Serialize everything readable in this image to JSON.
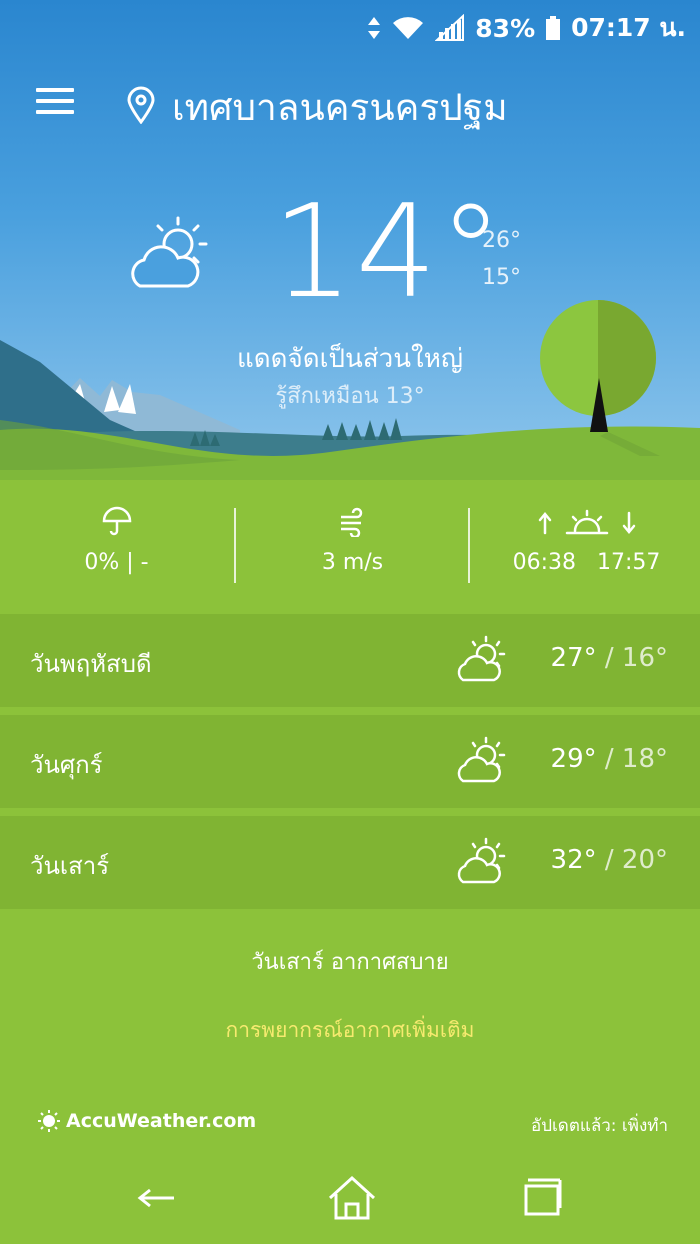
{
  "status_bar": {
    "battery": "83%",
    "time": "07:17 น."
  },
  "header": {
    "location": "เทศบาลนครนครปฐม"
  },
  "current": {
    "temperature": "14°",
    "high": "26°",
    "low": "15°",
    "condition": "แดดจัดเป็นส่วนใหญ่",
    "feels_like": "รู้สึกเหมือน 13°",
    "icon": "partly-sunny-icon"
  },
  "stats": {
    "precipitation": "0% | -",
    "wind": "3 m/s",
    "sunrise": "06:38",
    "sunset": "17:57"
  },
  "forecast": [
    {
      "day": "วันพฤหัสบดี",
      "high": "27°",
      "low": "/ 16°",
      "icon": "partly-sunny-icon"
    },
    {
      "day": "วันศุกร์",
      "high": "29°",
      "low": "/ 18°",
      "icon": "partly-sunny-icon"
    },
    {
      "day": "วันเสาร์",
      "high": "32°",
      "low": "/ 20°",
      "icon": "partly-sunny-icon"
    }
  ],
  "summary": "วันเสาร์ อากาศสบาย",
  "more_link": "การพยากรณ์อากาศเพิ่มเติม",
  "footer": {
    "brand": "AccuWeather.com",
    "updated": "อัปเดตแล้ว: เพิ่งทำ"
  },
  "colors": {
    "sky_top": "#2a86cf",
    "grass": "#8cc23a",
    "row_bg": "#80b433",
    "link": "#f6ea6f"
  }
}
